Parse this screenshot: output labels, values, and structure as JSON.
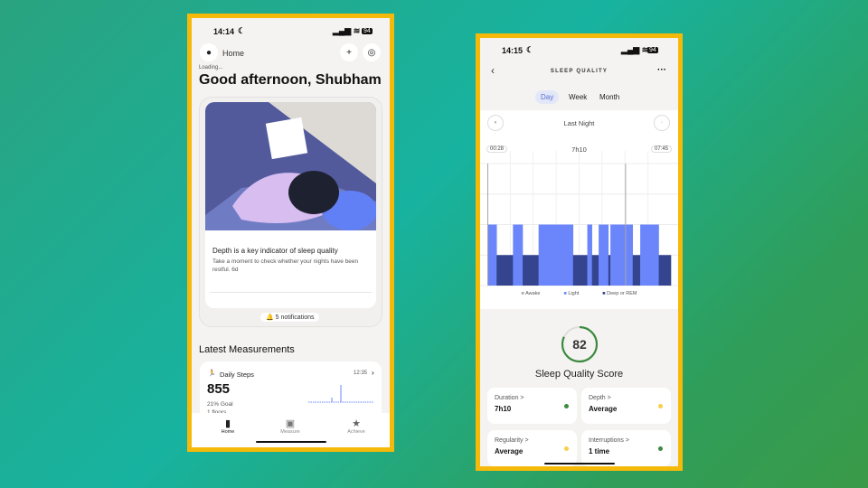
{
  "left": {
    "status": {
      "time": "14:14",
      "battery": "94"
    },
    "header": {
      "title": "Home",
      "loading": "Loading...",
      "greeting": "Good afternoon, Shubham"
    },
    "card": {
      "title": "Depth is a key indicator of sleep quality",
      "body": "Take a moment to check whether your nights have been restful. 6d",
      "notifications": "5 notifications"
    },
    "latest": {
      "heading": "Latest Measurements",
      "steps": {
        "label": "Daily Steps",
        "time": "12:35",
        "value": "855",
        "goal": "21% Goal",
        "floors": "1 floors"
      }
    },
    "nav": [
      {
        "label": "Home",
        "icon": "bookmark-icon"
      },
      {
        "label": "Measure",
        "icon": "chart-icon"
      },
      {
        "label": "Achieve",
        "icon": "star-icon"
      }
    ]
  },
  "right": {
    "status": {
      "time": "14:15",
      "battery": "94"
    },
    "header": {
      "title": "SLEEP QUALITY"
    },
    "tabs": [
      "Day",
      "Week",
      "Month"
    ],
    "active_tab": "Day",
    "period": "Last Night",
    "chart_data": {
      "type": "timeline",
      "start": "00:28",
      "end": "07:45",
      "duration": "7h10",
      "legend": [
        "Awake",
        "Light",
        "Deep or REM"
      ],
      "colors": {
        "Awake": "#a9a6a3",
        "Light": "#6b86fb",
        "Deep or REM": "#34448f"
      },
      "segments": [
        {
          "stage": "Light",
          "from": "00:28",
          "to": "00:50"
        },
        {
          "stage": "Deep or REM",
          "from": "00:50",
          "to": "01:29"
        },
        {
          "stage": "Light",
          "from": "01:29",
          "to": "01:52"
        },
        {
          "stage": "Deep or REM",
          "from": "01:52",
          "to": "02:30"
        },
        {
          "stage": "Light",
          "from": "02:30",
          "to": "03:52"
        },
        {
          "stage": "Deep or REM",
          "from": "03:52",
          "to": "04:26"
        },
        {
          "stage": "Light",
          "from": "04:26",
          "to": "04:37"
        },
        {
          "stage": "Deep or REM",
          "from": "04:37",
          "to": "04:53"
        },
        {
          "stage": "Light",
          "from": "04:53",
          "to": "05:16"
        },
        {
          "stage": "Deep or REM",
          "from": "05:16",
          "to": "05:21"
        },
        {
          "stage": "Light",
          "from": "05:21",
          "to": "06:14"
        },
        {
          "stage": "Deep or REM",
          "from": "06:14",
          "to": "06:32"
        },
        {
          "stage": "Light",
          "from": "06:32",
          "to": "07:16"
        },
        {
          "stage": "Deep or REM",
          "from": "07:16",
          "to": "07:45"
        }
      ],
      "awake": [
        {
          "from": "00:28",
          "to": "00:29"
        },
        {
          "from": "05:56",
          "to": "05:58"
        }
      ]
    },
    "score": {
      "value": 82,
      "label": "Sleep Quality Score",
      "color": "#3c8a3f"
    },
    "metrics": [
      {
        "label": "Duration >",
        "value": "7h10",
        "color": "#3c8a3f"
      },
      {
        "label": "Depth >",
        "value": "Average",
        "color": "#f7cf4a"
      },
      {
        "label": "Regularity >",
        "value": "Average",
        "color": "#f7cf4a"
      },
      {
        "label": "Interruptions >",
        "value": "1 time",
        "color": "#3c8a3f"
      }
    ]
  }
}
